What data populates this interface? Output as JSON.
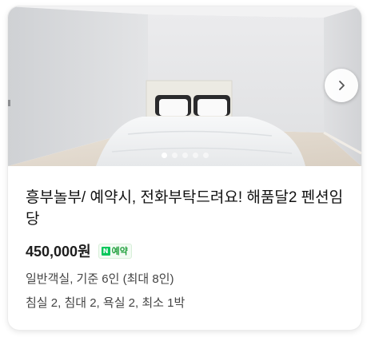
{
  "listing": {
    "title": "흥부놀부/ 예약시, 전화부탁드려요! 해품달2 펜션임당",
    "price": "450,000원",
    "badge": {
      "icon": "naver-n-icon",
      "icon_letter": "N",
      "label": "예약",
      "color": "#1d9e3a"
    },
    "room_info": "일반객실, 기준 6인 (최대 8인)",
    "room_details": "침실 2, 침대 2, 욕실 2, 최소 1박"
  },
  "gallery": {
    "photo": "bedroom-photo",
    "dot_count": 5,
    "active_dot": 1,
    "next_icon": "chevron-right-icon"
  }
}
